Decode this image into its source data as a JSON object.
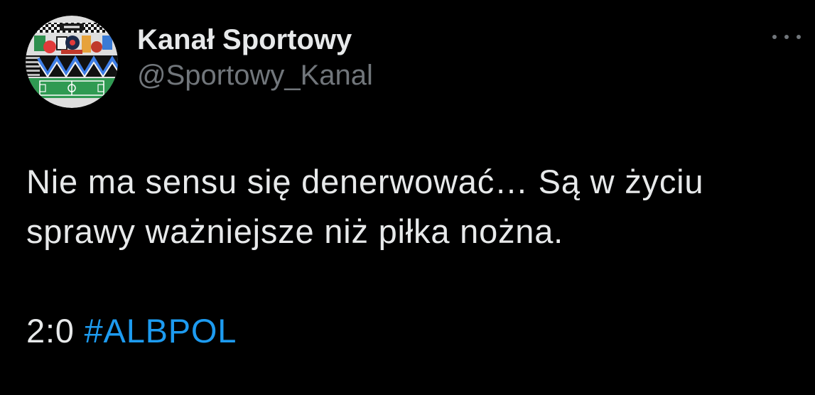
{
  "tweet": {
    "author": {
      "display_name": "Kanał Sportowy",
      "handle": "@Sportowy_Kanal",
      "avatar_icon": "kanal-sportowy-logo"
    },
    "more_icon": "more-horizontal-icon",
    "text": "Nie ma sensu się denerwować… Są w życiu sprawy ważniejsze niż piłka nożna.",
    "score": "2:0",
    "hashtag": "#ALBPOL"
  },
  "theme": {
    "background": "#000000",
    "text": "#e7e9ea",
    "secondary_text": "#71767b",
    "link": "#1d9bf0"
  }
}
